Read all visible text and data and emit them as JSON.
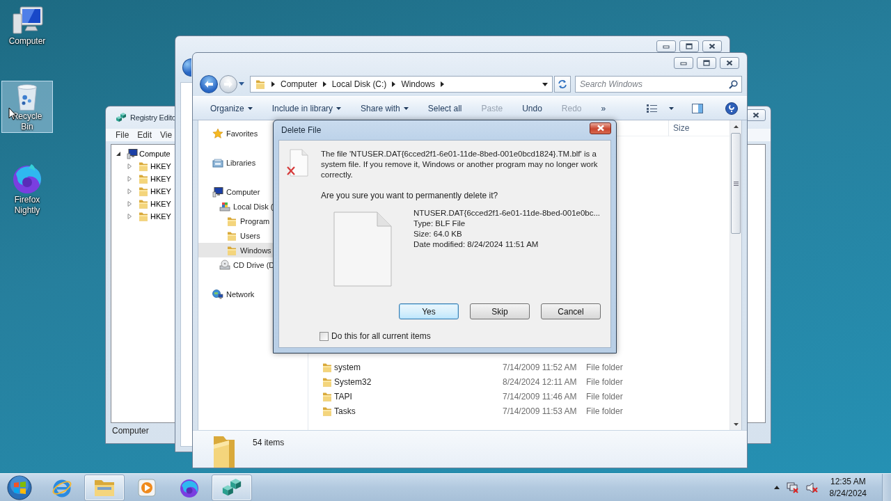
{
  "desktop_icons": [
    {
      "kind": "computer",
      "label": "Computer",
      "selected": false
    },
    {
      "kind": "recycle_bin",
      "label": "Recycle Bin",
      "selected": true
    },
    {
      "kind": "firefox",
      "label": "Firefox Nightly",
      "selected": false
    }
  ],
  "registry_editor": {
    "title": "Registry Edito",
    "menu": [
      "File",
      "Edit",
      "Vie"
    ],
    "tree": [
      {
        "label": "Compute",
        "expanded": true,
        "children": [
          {
            "label": "HKEY",
            "expanded": false
          },
          {
            "label": "HKEY",
            "expanded": false
          },
          {
            "label": "HKEY",
            "expanded": false
          },
          {
            "label": "HKEY",
            "expanded": false
          },
          {
            "label": "HKEY",
            "expanded": false
          }
        ]
      }
    ],
    "status_bar": "Computer"
  },
  "explorer": {
    "breadcrumb": [
      "Computer",
      "Local Disk (C:)",
      "Windows"
    ],
    "search": {
      "placeholder": "Search Windows"
    },
    "toolbar": [
      {
        "label": "Organize",
        "dropdown": true,
        "disabled": false
      },
      {
        "label": "Include in library",
        "dropdown": true,
        "disabled": false
      },
      {
        "label": "Share with",
        "dropdown": true,
        "disabled": false
      },
      {
        "label": "Select all",
        "dropdown": false,
        "disabled": false
      },
      {
        "label": "Paste",
        "dropdown": false,
        "disabled": true
      },
      {
        "label": "Undo",
        "dropdown": false,
        "disabled": false
      },
      {
        "label": "Redo",
        "dropdown": false,
        "disabled": true
      },
      {
        "label": "»",
        "dropdown": false,
        "disabled": false
      }
    ],
    "navigation": [
      {
        "kind": "favorites",
        "label": "Favorites",
        "selected": false
      },
      {
        "kind": "libraries",
        "label": "Libraries",
        "selected": false
      },
      {
        "kind": "computer",
        "label": "Computer",
        "selected": false,
        "children": [
          {
            "kind": "disk",
            "label": "Local Disk (",
            "selected": false,
            "children": [
              {
                "kind": "folder",
                "label": "Program",
                "selected": false
              },
              {
                "kind": "folder",
                "label": "Users",
                "selected": false
              },
              {
                "kind": "folder",
                "label": "Windows",
                "selected": true
              }
            ]
          },
          {
            "kind": "cd",
            "label": "CD Drive (D",
            "selected": false
          }
        ]
      },
      {
        "kind": "network",
        "label": "Network",
        "selected": false
      }
    ],
    "columns": [
      "Size"
    ],
    "files": [
      {
        "name": "system",
        "date_modified": "7/14/2009 11:52 AM",
        "type": "File folder"
      },
      {
        "name": "System32",
        "date_modified": "8/24/2024 12:11 AM",
        "type": "File folder"
      },
      {
        "name": "TAPI",
        "date_modified": "7/14/2009 11:46 AM",
        "type": "File folder"
      },
      {
        "name": "Tasks",
        "date_modified": "7/14/2009 11:53 AM",
        "type": "File folder"
      }
    ],
    "status": "54 items"
  },
  "dialog": {
    "title": "Delete File",
    "message": "The file 'NTUSER.DAT{6cced2f1-6e01-11de-8bed-001e0bcd1824}.TM.blf' is a system file. If you remove it, Windows or another program may no longer work correctly.",
    "question": "Are you sure you want to permanently delete it?",
    "file": {
      "name": "NTUSER.DAT{6cced2f1-6e01-11de-8bed-001e0bc...",
      "type": "Type: BLF File",
      "size": "Size: 64.0 KB",
      "date_modified": "Date modified: 8/24/2024 11:51 AM"
    },
    "buttons": [
      {
        "label": "Yes",
        "default": true
      },
      {
        "label": "Skip",
        "default": false
      },
      {
        "label": "Cancel",
        "default": false
      }
    ],
    "checkbox": {
      "label": "Do this for all current items",
      "checked": false
    }
  },
  "taskbar": {
    "apps": [
      {
        "kind": "internet_explorer",
        "running": false
      },
      {
        "kind": "explorer",
        "running": true
      },
      {
        "kind": "media_player",
        "running": false
      },
      {
        "kind": "firefox",
        "running": false
      },
      {
        "kind": "registry_editor",
        "running": true
      }
    ],
    "clock": {
      "time": "12:35 AM",
      "date": "8/24/2024"
    }
  }
}
